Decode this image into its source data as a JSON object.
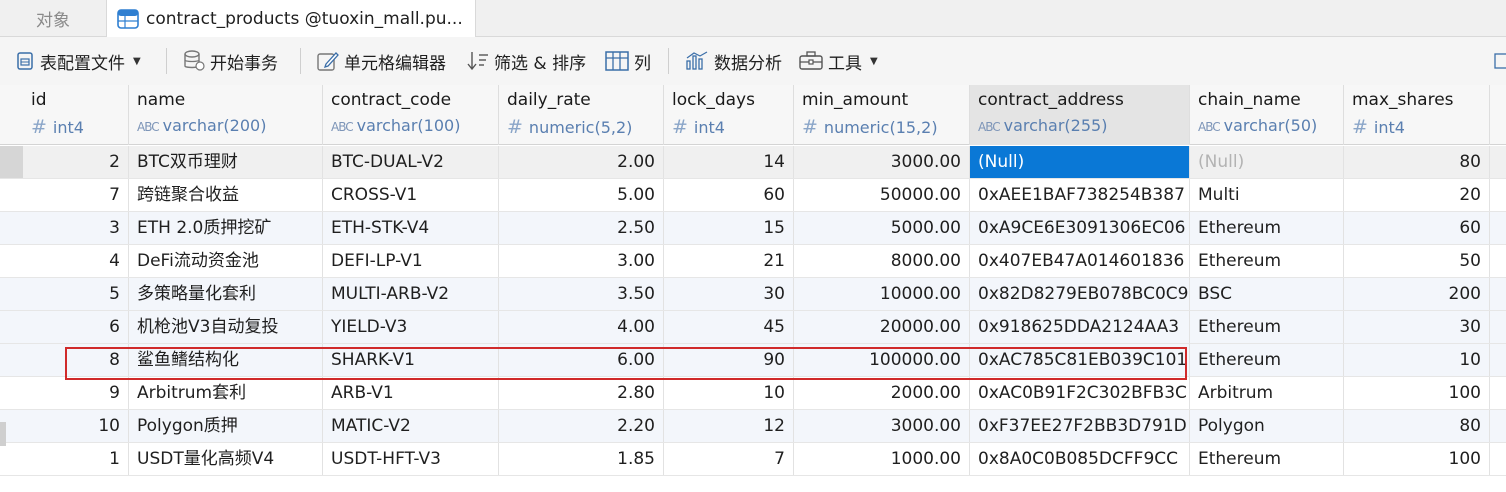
{
  "tabs": {
    "objects_label": "对象",
    "active_label": "contract_products @tuoxin_mall.pu..."
  },
  "toolbar": {
    "table_config": "表配置文件",
    "begin_transaction": "开始事务",
    "cell_editor": "单元格编辑器",
    "filter_sort": "筛选 & 排序",
    "columns": "列",
    "data_analysis": "数据分析",
    "tools": "工具"
  },
  "columns": [
    {
      "name": "id",
      "type": "int4",
      "kind": "num"
    },
    {
      "name": "name",
      "type": "varchar(200)",
      "kind": "str"
    },
    {
      "name": "contract_code",
      "type": "varchar(100)",
      "kind": "str"
    },
    {
      "name": "daily_rate",
      "type": "numeric(5,2)",
      "kind": "num"
    },
    {
      "name": "lock_days",
      "type": "int4",
      "kind": "num"
    },
    {
      "name": "min_amount",
      "type": "numeric(15,2)",
      "kind": "num"
    },
    {
      "name": "contract_address",
      "type": "varchar(255)",
      "kind": "str"
    },
    {
      "name": "chain_name",
      "type": "varchar(50)",
      "kind": "str"
    },
    {
      "name": "max_shares",
      "type": "int4",
      "kind": "num"
    }
  ],
  "null_label": "(Null)",
  "rows": [
    [
      "2",
      "BTC双币理财",
      "BTC-DUAL-V2",
      "2.00",
      "14",
      "3000.00",
      "(Null)",
      "(Null)",
      "80"
    ],
    [
      "7",
      "跨链聚合收益",
      "CROSS-V1",
      "5.00",
      "60",
      "50000.00",
      "0xAEE1BAF738254B387",
      "Multi",
      "20"
    ],
    [
      "3",
      "ETH 2.0质押挖矿",
      "ETH-STK-V4",
      "2.50",
      "15",
      "5000.00",
      "0xA9CE6E3091306EC06",
      "Ethereum",
      "60"
    ],
    [
      "4",
      "DeFi流动资金池",
      "DEFI-LP-V1",
      "3.00",
      "21",
      "8000.00",
      "0x407EB47A014601836",
      "Ethereum",
      "50"
    ],
    [
      "5",
      "多策略量化套利",
      "MULTI-ARB-V2",
      "3.50",
      "30",
      "10000.00",
      "0x82D8279EB078BC0C9",
      "BSC",
      "200"
    ],
    [
      "6",
      "机枪池V3自动复投",
      "YIELD-V3",
      "4.00",
      "45",
      "20000.00",
      "0x918625DDA2124AA3",
      "Ethereum",
      "30"
    ],
    [
      "8",
      "鲨鱼鳍结构化",
      "SHARK-V1",
      "6.00",
      "90",
      "100000.00",
      "0xAC785C81EB039C101",
      "Ethereum",
      "10"
    ],
    [
      "9",
      "Arbitrum套利",
      "ARB-V1",
      "2.80",
      "10",
      "2000.00",
      "0xAC0B91F2C302BFB3C",
      "Arbitrum",
      "100"
    ],
    [
      "10",
      "Polygon质押",
      "MATIC-V2",
      "2.20",
      "12",
      "3000.00",
      "0xF37EE27F2BB3D791D",
      "Polygon",
      "80"
    ],
    [
      "1",
      "USDT量化高频V4",
      "USDT-HFT-V3",
      "1.85",
      "7",
      "1000.00",
      "0x8A0C0B085DCFF9CC",
      "Ethereum",
      "100"
    ]
  ],
  "colors": {
    "selection": "#0a78d6",
    "highlight_border": "#d02a2a",
    "type_text": "#5a7fb0"
  }
}
